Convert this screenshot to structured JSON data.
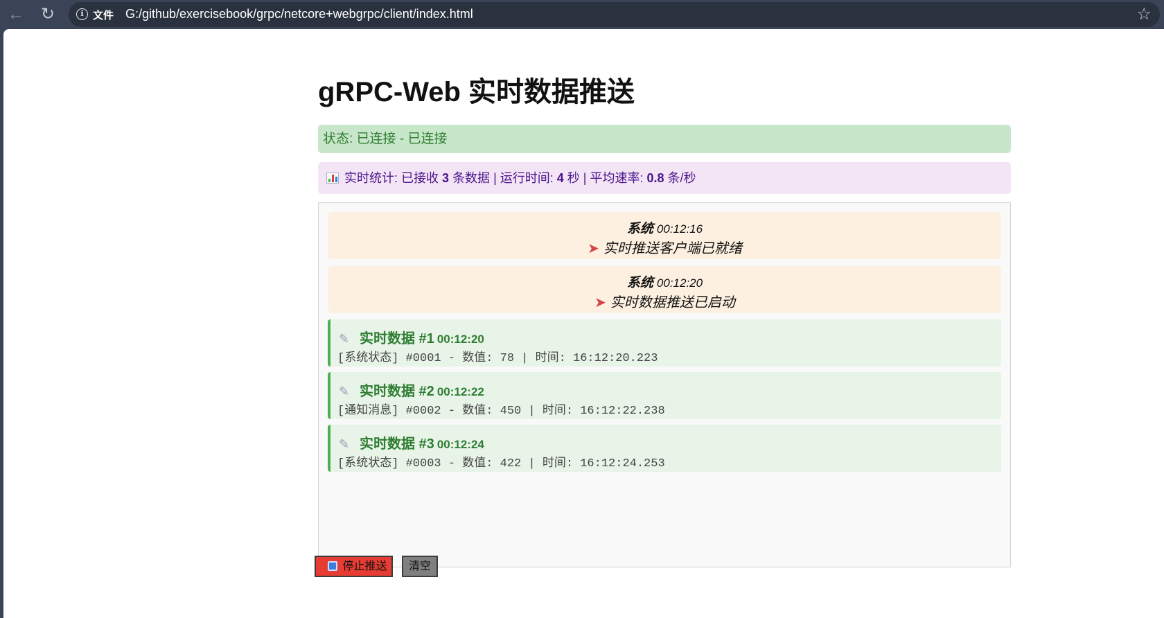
{
  "browser": {
    "file_label": "文件",
    "url": "G:/github/exercisebook/grpc/netcore+webgrpc/client/index.html",
    "icons": {
      "back": "back-arrow-icon",
      "reload": "reload-icon",
      "info": "info-icon",
      "bookmark": "star-icon"
    }
  },
  "page": {
    "title": "gRPC-Web 实时数据推送",
    "status": "状态: 已连接 - 已连接",
    "stats": {
      "label": "实时统计: 已接收",
      "received": "3",
      "received_unit": "条数据 | 运行时间:",
      "runtime": "4",
      "runtime_unit": "秒 | 平均速率:",
      "rate": "0.8",
      "rate_unit": "条/秒",
      "icon": "bar-chart-icon"
    },
    "system_messages": [
      {
        "sender": "系统",
        "time": "00:12:16",
        "text": "实时推送客户端已就绪",
        "icon": "rocket-icon"
      },
      {
        "sender": "系统",
        "time": "00:12:20",
        "text": "实时数据推送已启动",
        "icon": "rocket-icon"
      }
    ],
    "data_messages": [
      {
        "title": "实时数据 #1",
        "time": "00:12:20",
        "content": "[系统状态] #0001 - 数值: 78 | 时间: 16:12:20.223",
        "icon": "satellite-icon"
      },
      {
        "title": "实时数据 #2",
        "time": "00:12:22",
        "content": "[通知消息] #0002 - 数值: 450 | 时间: 16:12:22.238",
        "icon": "satellite-icon"
      },
      {
        "title": "实时数据 #3",
        "time": "00:12:24",
        "content": "[系统状态] #0003 - 数值: 422 | 时间: 16:12:24.253",
        "icon": "satellite-icon"
      }
    ],
    "buttons": {
      "stop": "停止推送",
      "clear": "清空"
    },
    "colors": {
      "status_bg": "#c8e6c9",
      "status_text": "#2e7d32",
      "stats_bg": "#f3e5f5",
      "stats_text": "#4a148c",
      "system_bg": "#fdf0e0",
      "data_bg": "#e8f4e8",
      "data_border": "#4caf50",
      "stop_button": "#e63c34",
      "clear_button": "#808080"
    }
  }
}
